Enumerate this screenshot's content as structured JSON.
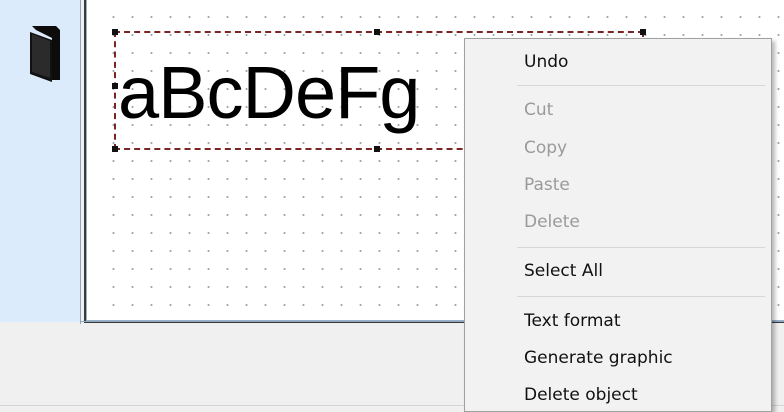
{
  "canvas": {
    "text_object": {
      "text": "aBcDeFg"
    }
  },
  "sidebar": {
    "icon": "phone-device-icon"
  },
  "context_menu": {
    "items": [
      {
        "label": "Undo",
        "enabled": true
      },
      {
        "label": "Cut",
        "enabled": false
      },
      {
        "label": "Copy",
        "enabled": false
      },
      {
        "label": "Paste",
        "enabled": false
      },
      {
        "label": "Delete",
        "enabled": false
      },
      {
        "label": "Select All",
        "enabled": true
      },
      {
        "label": "Text format",
        "enabled": true
      },
      {
        "label": "Generate graphic",
        "enabled": true
      },
      {
        "label": "Delete object",
        "enabled": true
      }
    ]
  },
  "colors": {
    "selection_border": "#7a2424",
    "sidebar_bg": "#dcebfb",
    "disabled_text": "#9a9a9a"
  }
}
